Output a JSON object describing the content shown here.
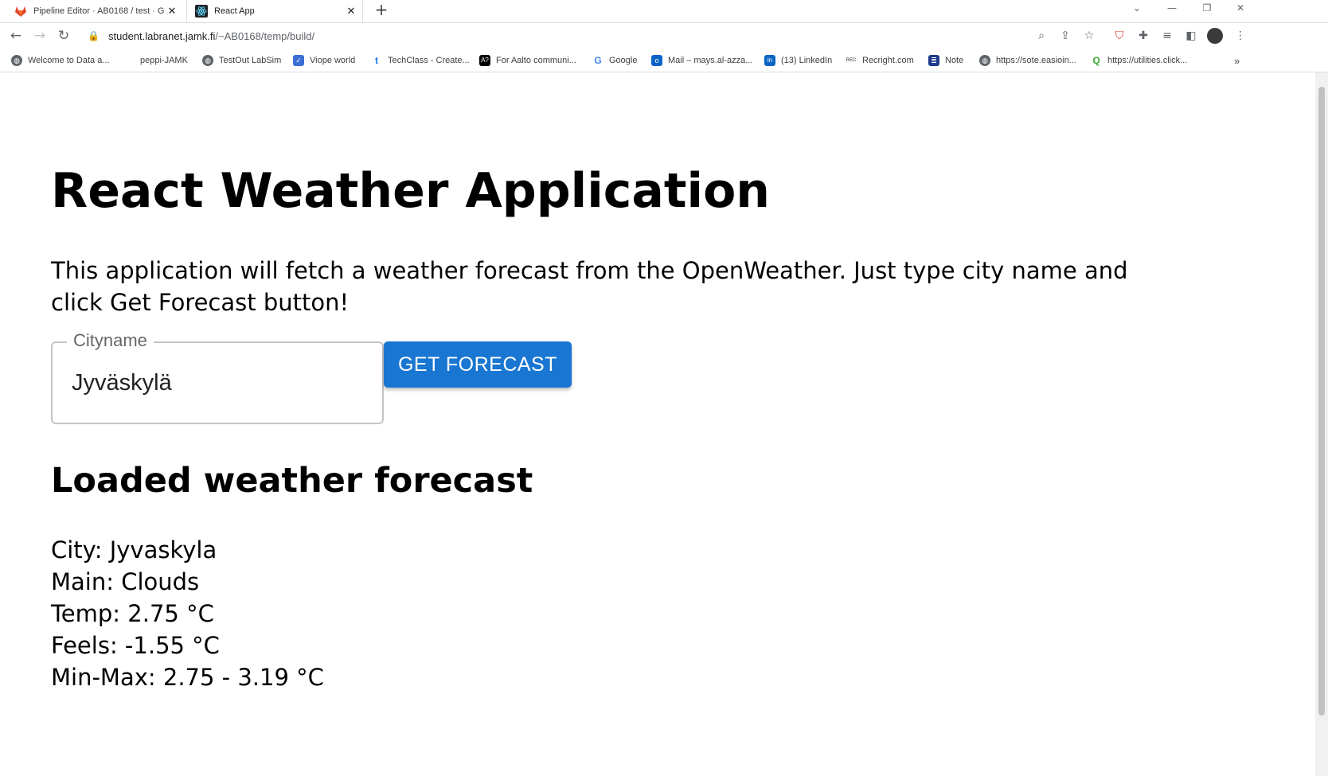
{
  "browser": {
    "tabs": [
      {
        "title": "Pipeline Editor · AB0168 / test · G",
        "active": false
      },
      {
        "title": "React App",
        "active": true
      }
    ],
    "new_tab_symbol": "+",
    "url_host": "student.labranet.jamk.fi",
    "url_path": "/~AB0168/temp/build/",
    "bookmarks": [
      {
        "label": "Welcome to Data a...",
        "icon": "globe-icon"
      },
      {
        "label": "peppi-JAMK",
        "icon": "none"
      },
      {
        "label": "TestOut LabSim",
        "icon": "globe-icon"
      },
      {
        "label": "Viope world",
        "icon": "viope-icon"
      },
      {
        "label": "TechClass - Create...",
        "icon": "techclass-icon"
      },
      {
        "label": "For Aalto communi...",
        "icon": "aalto-icon"
      },
      {
        "label": "Google",
        "icon": "google-icon"
      },
      {
        "label": "Mail – mays.al-azza...",
        "icon": "outlook-icon"
      },
      {
        "label": "(13) LinkedIn",
        "icon": "linkedin-icon"
      },
      {
        "label": "Recright.com",
        "icon": "recright-icon"
      },
      {
        "label": "Note",
        "icon": "note-icon"
      },
      {
        "label": "https://sote.easioin...",
        "icon": "globe-icon"
      },
      {
        "label": "https://utilities.click...",
        "icon": "utilities-icon"
      }
    ],
    "bookmarks_overflow": "»"
  },
  "app": {
    "title": "React Weather Application",
    "intro": "This application will fetch a weather forecast from the OpenWeather. Just type city name and click Get Forecast button!",
    "city_field_label": "Cityname",
    "city_field_value": "Jyväskylä",
    "forecast_button": "GET FORECAST",
    "forecast_heading": "Loaded weather forecast",
    "forecast": {
      "city": "City: Jyvaskyla",
      "main": "Main: Clouds",
      "temp": "Temp: 2.75 °C",
      "feels": "Feels: -1.55 °C",
      "minmax": "Min-Max: 2.75 - 3.19 °C"
    }
  },
  "colors": {
    "primary_button": "#1976d2",
    "field_border": "#c4c4c4"
  }
}
